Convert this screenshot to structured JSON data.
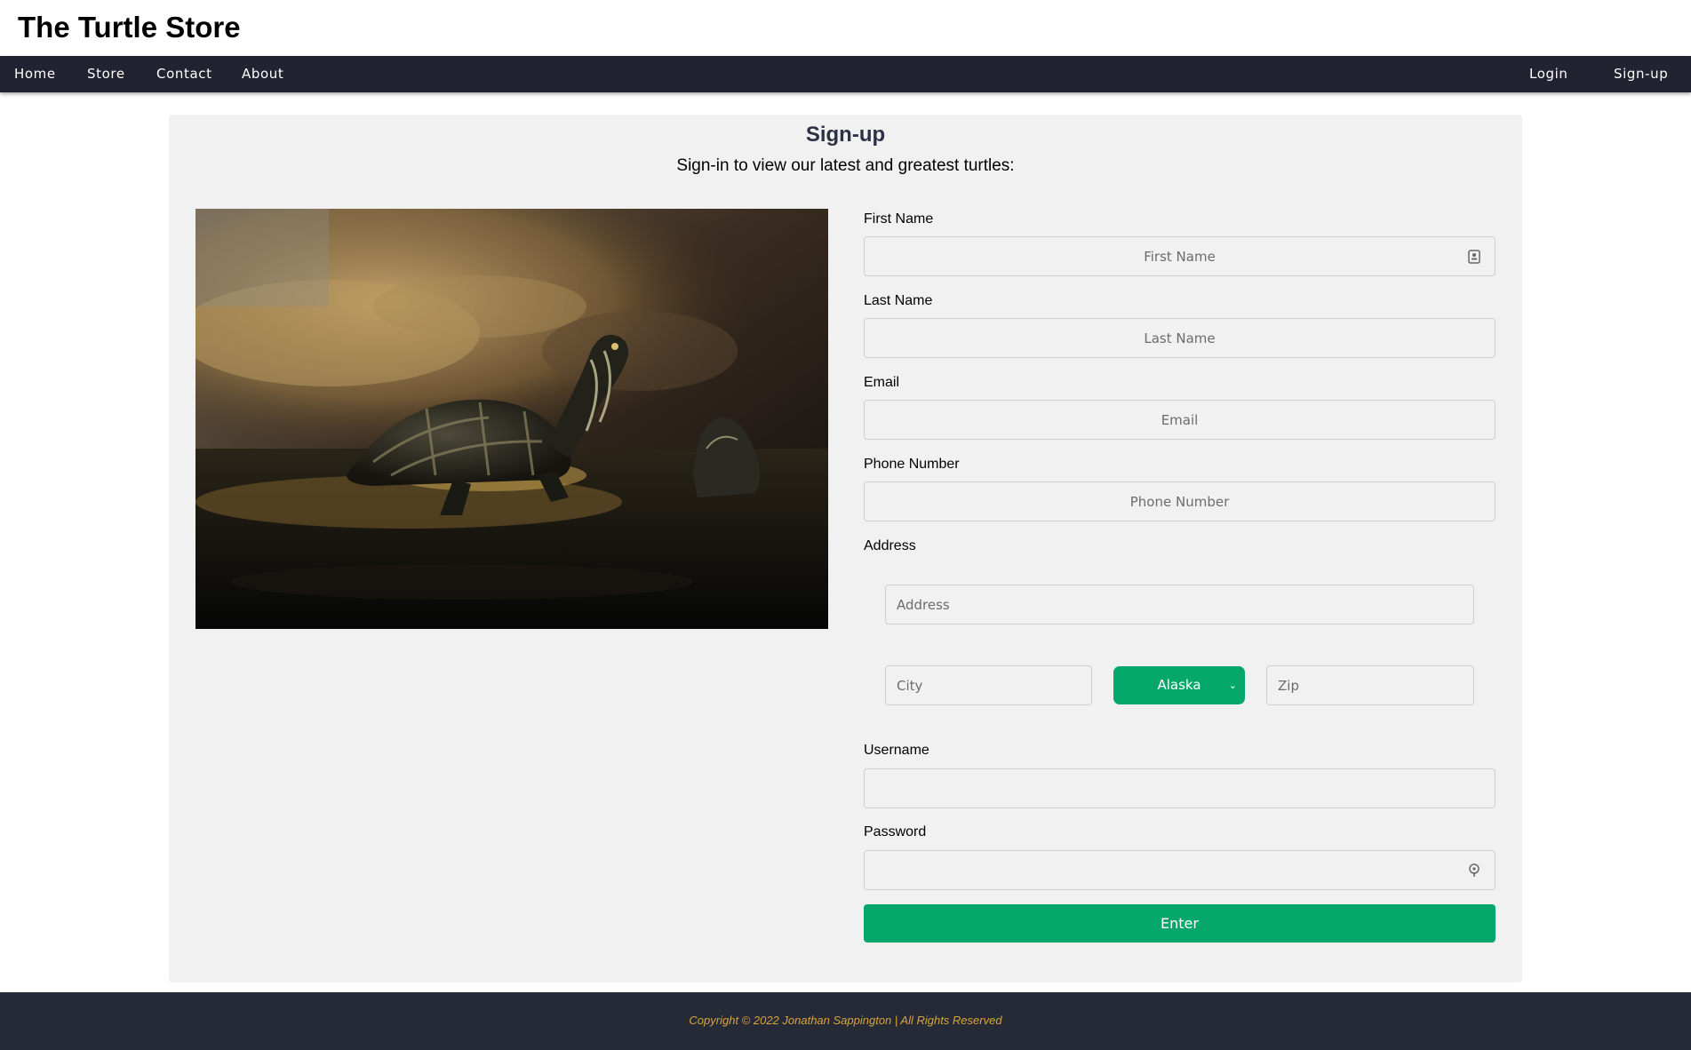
{
  "site": {
    "title": "The Turtle Store"
  },
  "nav": {
    "left": [
      {
        "label": "Home"
      },
      {
        "label": "Store"
      },
      {
        "label": "Contact"
      },
      {
        "label": "About"
      }
    ],
    "right": [
      {
        "label": "Login"
      },
      {
        "label": "Sign-up"
      }
    ]
  },
  "signup": {
    "title": "Sign-up",
    "subtitle": "Sign-in to view our latest and greatest turtles:",
    "fields": {
      "first_name": {
        "label": "First Name",
        "placeholder": "First Name",
        "value": ""
      },
      "last_name": {
        "label": "Last Name",
        "placeholder": "Last Name",
        "value": ""
      },
      "email": {
        "label": "Email",
        "placeholder": "Email",
        "value": ""
      },
      "phone": {
        "label": "Phone Number",
        "placeholder": "Phone Number",
        "value": ""
      },
      "address_label": "Address",
      "address": {
        "placeholder": "Address",
        "value": ""
      },
      "city": {
        "placeholder": "City",
        "value": ""
      },
      "state": {
        "selected": "Alaska"
      },
      "zip": {
        "placeholder": "Zip",
        "value": ""
      },
      "username": {
        "label": "Username",
        "value": ""
      },
      "password": {
        "label": "Password",
        "value": ""
      }
    },
    "submit_label": "Enter",
    "icons": {
      "first_name_icon": "contact-card-icon",
      "password_icon": "key-icon",
      "state_chevron": "chevron-down-icon"
    }
  },
  "footer": {
    "text": "Copyright © 2022 Jonathan Sappington | All Rights Reserved"
  },
  "colors": {
    "nav_bg": "#212330",
    "accent_green": "#05a86a",
    "footer_bg": "#262a37",
    "footer_text": "#d4a53a",
    "card_bg": "#f1f1f1",
    "title_color": "#2c3244"
  }
}
